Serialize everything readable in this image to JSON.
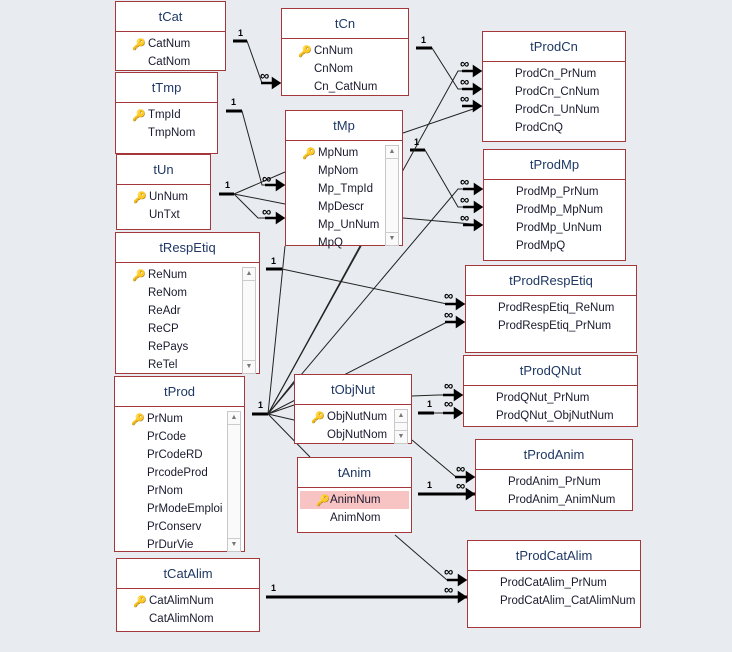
{
  "relation_labels": {
    "one": "1",
    "many": "∞"
  },
  "tables": {
    "tCat": {
      "title": "tCat",
      "fields": [
        "CatNum",
        "CatNom"
      ]
    },
    "tCn": {
      "title": "tCn",
      "fields": [
        "CnNum",
        "CnNom",
        "Cn_CatNum"
      ]
    },
    "tTmp": {
      "title": "tTmp",
      "fields": [
        "TmpId",
        "TmpNom"
      ]
    },
    "tUn": {
      "title": "tUn",
      "fields": [
        "UnNum",
        "UnTxt"
      ]
    },
    "tMp": {
      "title": "tMp",
      "fields": [
        "MpNum",
        "MpNom",
        "Mp_TmpId",
        "MpDescr",
        "Mp_UnNum",
        "MpQ"
      ]
    },
    "tRespEtiq": {
      "title": "tRespEtiq",
      "fields": [
        "ReNum",
        "ReNom",
        "ReAdr",
        "ReCP",
        "RePays",
        "ReTel"
      ]
    },
    "tProd": {
      "title": "tProd",
      "fields": [
        "PrNum",
        "PrCode",
        "PrCodeRD",
        "PrcodeProd",
        "PrNom",
        "PrModeEmploi",
        "PrConserv",
        "PrDurVie"
      ]
    },
    "tObjNut": {
      "title": "tObjNut",
      "fields": [
        "ObjNutNum",
        "ObjNutNom"
      ]
    },
    "tAnim": {
      "title": "tAnim",
      "fields": [
        "AnimNum",
        "AnimNom"
      ]
    },
    "tCatAlim": {
      "title": "tCatAlim",
      "fields": [
        "CatAlimNum",
        "CatAlimNom"
      ]
    },
    "tProdCn": {
      "title": "tProdCn",
      "fields": [
        "ProdCn_PrNum",
        "ProdCn_CnNum",
        "ProdCn_UnNum",
        "ProdCnQ"
      ]
    },
    "tProdMp": {
      "title": "tProdMp",
      "fields": [
        "ProdMp_PrNum",
        "ProdMp_MpNum",
        "ProdMp_UnNum",
        "ProdMpQ"
      ]
    },
    "tProdRespEtiq": {
      "title": "tProdRespEtiq",
      "fields": [
        "ProdRespEtiq_ReNum",
        "ProdRespEtiq_PrNum"
      ]
    },
    "tProdQNut": {
      "title": "tProdQNut",
      "fields": [
        "ProdQNut_PrNum",
        "ProdQNut_ObjNutNum"
      ]
    },
    "tProdAnim": {
      "title": "tProdAnim",
      "fields": [
        "ProdAnim_PrNum",
        "ProdAnim_AnimNum"
      ]
    },
    "tProdCatAlim": {
      "title": "tProdCatAlim",
      "fields": [
        "ProdCatAlim_PrNum",
        "ProdCatAlim_CatAlimNum"
      ]
    }
  },
  "selected_field": "tAnim.AnimNum",
  "colors": {
    "table_border": "#a4373a",
    "selected_row": "#f8c3c3",
    "background": "#e8ebef"
  }
}
